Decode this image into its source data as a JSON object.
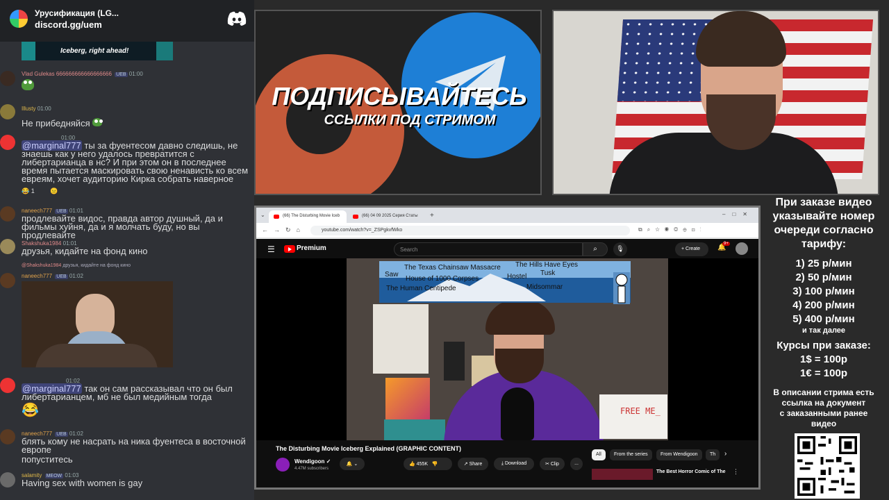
{
  "discord": {
    "server_name": "Урусификация (LG...",
    "invite": "discord.gg/uem",
    "top_image_caption": "Iceberg, right ahead!",
    "messages": [
      {
        "user": "Vlad Gulekas",
        "user_color": "#e08a8a",
        "text_inline": "666666666666666666",
        "time": "01:00",
        "badge": "UEB"
      },
      {
        "user": "Illusty",
        "user_color": "#e0b84a",
        "time": "01:00",
        "text": "Не прибедняйся"
      },
      {
        "time": "01:00",
        "mention": "@marginal777",
        "text": "ты за фуентесом давно следишь, не знаешь как у него удалось превратится с либертарианца в нс? И при этом он в последнее время пытается маскировать свою ненависть ко всем евреям, хочет аудиторию Кирка собрать наверное",
        "reaction_count": "1"
      },
      {
        "user": "naneech777",
        "user_color": "#e0a24a",
        "time": "01:01",
        "badge": "UEB",
        "text": "продлевайте видос, правда автор душный, да и фильмы хуйня, да и я молчать буду, но вы продлевайте"
      },
      {
        "user": "Shakshuka1984",
        "user_color": "#e08a8a",
        "time": "01:01",
        "text": "друзья, кидайте на фонд кино"
      },
      {
        "reply_user": "@Shakshuka1984",
        "reply_text": "друзья, кидайте на фонд кино",
        "user": "naneech777",
        "user_color": "#e0a24a",
        "time": "01:02",
        "badge": "UEB"
      },
      {
        "time": "01:02",
        "mention": "@marginal777",
        "text": "так он сам рассказывал что он был либертарианцем, мб не был медийным тогда"
      },
      {
        "user": "naneech777",
        "user_color": "#e0a24a",
        "time": "01:02",
        "badge": "UEB",
        "text": "блять кому не насрать на ника фуентеса в восточной европе",
        "text2": "попуститесь"
      },
      {
        "user": "salamity",
        "user_color": "#e0b84a",
        "time": "01:03",
        "badge": "MEOW",
        "text": "Having sex with women is gay"
      }
    ]
  },
  "promo": {
    "title": "ПОДПИСЫВАЙТЕСЬ",
    "subtitle": "ССЫЛКИ ПОД СТРИМОМ"
  },
  "browser": {
    "tabs": [
      "(66) The Disturbing Movie Iceb",
      "(66) 04 09 2025 Серия Статы"
    ],
    "url": "youtube.com/watch?v=_ZSPgkvfWko"
  },
  "youtube": {
    "brand": "Premium",
    "search_placeholder": "Search",
    "create_label": "Create",
    "notif_count": "9+",
    "iceberg_labels": [
      "The Texas Chainsaw Massacre",
      "The Hills Have Eyes",
      "Saw",
      "House of 1000 Corpses",
      "Hostel",
      "Tusk",
      "The Human Centipede",
      "Midsommar"
    ],
    "sign_text": "FREE ME_",
    "video_title": "The Disturbing Movie Iceberg Explained (GRAPHIC CONTENT)",
    "channel": "Wendigoon",
    "subscribers": "4.47M subscribers",
    "likes": "455K",
    "share": "Share",
    "download": "Download",
    "clip": "Clip",
    "more": "...",
    "chips": [
      "All",
      "From the series",
      "From Wendigoon",
      "Th"
    ],
    "rec_title": "The Best Horror Comic of The"
  },
  "info": {
    "heading": [
      "При заказе видео",
      "указывайте номер",
      "очереди согласно",
      "тарифу:"
    ],
    "tiers": [
      "1) 25 р/мин",
      "2) 50 р/мин",
      "3) 100 р/мин",
      "4) 200 р/мин",
      "5) 400 р/мин"
    ],
    "etc": "и так далее",
    "courses_heading": "Курсы при заказе:",
    "usd": "1$ = 100р",
    "eur": "1€ = 100р",
    "desc": [
      "В описании стрима есть",
      "ссылка на документ",
      "с заказанными ранее",
      "видео"
    ]
  }
}
